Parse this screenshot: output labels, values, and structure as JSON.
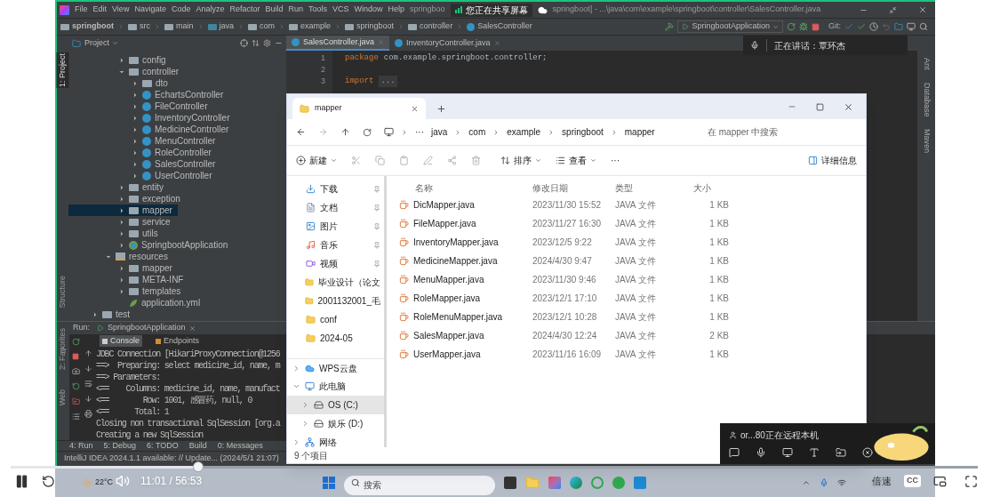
{
  "ide": {
    "menu": [
      "File",
      "Edit",
      "View",
      "Navigate",
      "Code",
      "Analyze",
      "Refactor",
      "Build",
      "Run",
      "Tools",
      "VCS",
      "Window",
      "Help"
    ],
    "title_start": "springboo",
    "title": "springboot] - ...\\java\\com\\example\\springboot\\controller\\SalesController.java",
    "sharing_badge": "您正在共享屏幕",
    "breadcrumb": [
      {
        "label": "springboot",
        "kind": "project"
      },
      {
        "label": "src",
        "kind": "folder"
      },
      {
        "label": "main",
        "kind": "folder"
      },
      {
        "label": "java",
        "kind": "source"
      },
      {
        "label": "com",
        "kind": "package"
      },
      {
        "label": "example",
        "kind": "package"
      },
      {
        "label": "springboot",
        "kind": "package"
      },
      {
        "label": "controller",
        "kind": "package"
      },
      {
        "label": "SalesController",
        "kind": "class"
      }
    ],
    "run_config": "SpringbootApplication",
    "vcs_label": "Git:",
    "speaking": "正在讲话：覃环杰",
    "project_view": "Project",
    "tabs": [
      {
        "label": "SalesController.java",
        "selected": true
      },
      {
        "label": "InventoryController.java",
        "selected": false
      }
    ],
    "left_tools": [
      {
        "label": "1: Project",
        "selected": true
      },
      {
        "label": "Structure",
        "selected": false
      },
      {
        "label": "2: Favorites",
        "selected": false
      },
      {
        "label": "Web",
        "selected": false
      }
    ],
    "right_tools": [
      "Ant",
      "Database",
      "Maven"
    ],
    "tree": [
      {
        "children": [
          {
            "children": [
              {
                "label": "config",
                "kind": "package",
                "expanded": false,
                "selected": false
              },
              {
                "label": "controller",
                "kind": "package",
                "expanded": true,
                "selected": false,
                "children": [
                  {
                    "label": "dto",
                    "kind": "package",
                    "expanded": false,
                    "selected": false
                  },
                  {
                    "label": "EchartsController",
                    "kind": "class",
                    "expanded": false,
                    "selected": false
                  },
                  {
                    "label": "FileController",
                    "kind": "class",
                    "expanded": false,
                    "selected": false
                  },
                  {
                    "label": "InventoryController",
                    "kind": "class",
                    "expanded": false,
                    "selected": false
                  },
                  {
                    "label": "MedicineController",
                    "kind": "class",
                    "expanded": false,
                    "selected": false
                  },
                  {
                    "label": "MenuController",
                    "kind": "class",
                    "expanded": false,
                    "selected": false
                  },
                  {
                    "label": "RoleController",
                    "kind": "class",
                    "expanded": false,
                    "selected": false
                  },
                  {
                    "label": "SalesController",
                    "kind": "class",
                    "expanded": false,
                    "selected": false
                  },
                  {
                    "label": "UserController",
                    "kind": "class",
                    "expanded": false,
                    "selected": false
                  }
                ]
              },
              {
                "label": "entity",
                "kind": "package",
                "expanded": false,
                "selected": false
              },
              {
                "label": "exception",
                "kind": "package",
                "expanded": false,
                "selected": false
              },
              {
                "label": "mapper",
                "kind": "package",
                "expanded": false,
                "selected": true
              },
              {
                "label": "service",
                "kind": "package",
                "expanded": false,
                "selected": false
              },
              {
                "label": "utils",
                "kind": "package",
                "expanded": false,
                "selected": false
              },
              {
                "label": "SpringbootApplication",
                "kind": "app",
                "expanded": false,
                "selected": false
              }
            ]
          },
          {
            "label": "resources",
            "kind": "resources",
            "expanded": true,
            "selected": false,
            "children": [
              {
                "label": "mapper",
                "kind": "folder",
                "expanded": false,
                "selected": false
              },
              {
                "label": "META-INF",
                "kind": "folder",
                "expanded": false,
                "selected": false
              },
              {
                "label": "templates",
                "kind": "folder",
                "expanded": false,
                "selected": false
              },
              {
                "label": "application.yml",
                "kind": "yml",
                "selected": false
              }
            ]
          }
        ]
      },
      {
        "label": "test",
        "kind": "folder",
        "expanded": false,
        "selected": false
      }
    ],
    "code": [
      {
        "number": "1",
        "keyword": "package",
        "text": "com.example.springboot.controller;"
      },
      {
        "number": "2"
      },
      {
        "number": "3",
        "keyword": "import",
        "text": "...",
        "kind": "folded"
      }
    ],
    "run": {
      "label": "Run:",
      "config": "SpringbootApplication",
      "subtabs": [
        {
          "label": "Console",
          "selected": true
        },
        {
          "label": "Endpoints",
          "selected": false
        }
      ],
      "console": [
        "JDBC Connection [HikariProxyConnection@1256",
        "==>  Preparing: select medicine_id, name, m",
        "==> Parameters: ",
        "<==    Columns: medicine_id, name, manufact",
        "<==        Row: 1001, 感冒药, null, 0",
        "<==      Total: 1",
        "Closing non transactional SqlSession [org.a",
        "Creating a new SqlSession"
      ]
    },
    "tool_buttons": [
      "4: Run",
      "5: Debug",
      "6: TODO",
      "Build",
      "0: Messages"
    ],
    "status": "IntelliJ IDEA 2024.1.1 available: // Update... (2024/5/1 21:07)"
  },
  "explorer": {
    "tab": "mapper",
    "path_overflow": "···",
    "path": [
      "java",
      "com",
      "example",
      "springboot",
      "mapper"
    ],
    "search_placeholder": "在 mapper 中搜索",
    "new_label": "新建",
    "sort_label": "排序",
    "view_label": "查看",
    "more_label": "···",
    "details_label": "详细信息",
    "sidebar": [
      {
        "label": "下载",
        "kind": "download",
        "pinned": true,
        "selected": false
      },
      {
        "label": "文档",
        "kind": "document",
        "pinned": true,
        "selected": false
      },
      {
        "label": "图片",
        "kind": "picture",
        "pinned": true,
        "selected": false
      },
      {
        "label": "音乐",
        "kind": "music",
        "pinned": true,
        "selected": false
      },
      {
        "label": "视频",
        "kind": "video",
        "pinned": true,
        "selected": false
      },
      {
        "label": "毕业设计（论文",
        "kind": "folder",
        "pinned": false,
        "selected": false
      },
      {
        "label": "2001132001_毛",
        "kind": "folder",
        "pinned": false,
        "selected": false
      },
      {
        "label": "conf",
        "kind": "folder",
        "pinned": false,
        "selected": false
      },
      {
        "label": "2024-05",
        "kind": "folder",
        "pinned": false,
        "selected": false
      },
      {
        "label": "WPS云盘",
        "kind": "cloud",
        "expanded": false,
        "selected": false,
        "separated": true
      },
      {
        "label": "此电脑",
        "kind": "pc",
        "expanded": true,
        "selected": false,
        "children": [
          {
            "label": "OS (C:)",
            "kind": "drive",
            "expanded": false,
            "selected": true
          },
          {
            "label": "娱乐 (D:)",
            "kind": "drive",
            "expanded": false,
            "selected": false
          }
        ]
      },
      {
        "label": "网络",
        "kind": "network",
        "expanded": false,
        "selected": false
      }
    ],
    "columns": [
      "名称",
      "修改日期",
      "类型",
      "大小"
    ],
    "files": [
      {
        "name": "DicMapper.java",
        "date": "2023/11/30 15:52",
        "type": "JAVA 文件",
        "size": "1 KB"
      },
      {
        "name": "FileMapper.java",
        "date": "2023/11/27 16:30",
        "type": "JAVA 文件",
        "size": "1 KB"
      },
      {
        "name": "InventoryMapper.java",
        "date": "2023/12/5 9:22",
        "type": "JAVA 文件",
        "size": "1 KB"
      },
      {
        "name": "MedicineMapper.java",
        "date": "2024/4/30 9:47",
        "type": "JAVA 文件",
        "size": "1 KB"
      },
      {
        "name": "MenuMapper.java",
        "date": "2023/11/30 9:46",
        "type": "JAVA 文件",
        "size": "1 KB"
      },
      {
        "name": "RoleMapper.java",
        "date": "2023/12/1 17:10",
        "type": "JAVA 文件",
        "size": "1 KB"
      },
      {
        "name": "RoleMenuMapper.java",
        "date": "2023/12/1 10:28",
        "type": "JAVA 文件",
        "size": "1 KB"
      },
      {
        "name": "SalesMapper.java",
        "date": "2024/4/30 12:24",
        "type": "JAVA 文件",
        "size": "2 KB"
      },
      {
        "name": "UserMapper.java",
        "date": "2023/11/16 16:09",
        "type": "JAVA 文件",
        "size": "1 KB"
      }
    ],
    "status": "9 个项目"
  },
  "remote": {
    "text": "or...80正在远程本机"
  },
  "taskbar": {
    "weather": "22°C",
    "search_placeholder": "搜索"
  },
  "player": {
    "level": 0.194,
    "time": "11:01 / 56:53",
    "speed": "倍速",
    "captions": "CC"
  }
}
